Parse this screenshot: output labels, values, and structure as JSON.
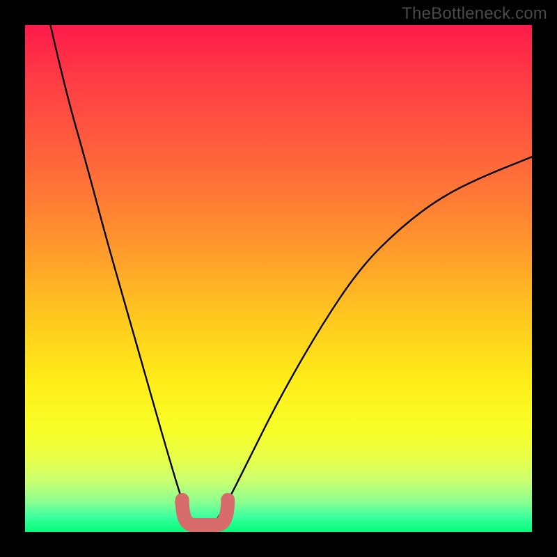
{
  "watermark": "TheBottleneck.com",
  "chart_data": {
    "type": "line",
    "title": "",
    "xlabel": "",
    "ylabel": "",
    "xlim": [
      0,
      100
    ],
    "ylim": [
      0,
      100
    ],
    "legend": false,
    "grid": false,
    "background_gradient": {
      "direction": "vertical",
      "stops": [
        {
          "pos": 0,
          "color": "#ff1a4a"
        },
        {
          "pos": 50,
          "color": "#ffc91f"
        },
        {
          "pos": 85,
          "color": "#f8ff28"
        },
        {
          "pos": 100,
          "color": "#00ff7a"
        }
      ]
    },
    "series": [
      {
        "name": "bottleneck-curve",
        "color": "#000000",
        "x": [
          5,
          8,
          12,
          16,
          20,
          24,
          28,
          31,
          33,
          35,
          37,
          40,
          44,
          50,
          58,
          66,
          74,
          82,
          90,
          100
        ],
        "y": [
          100,
          87,
          73,
          58,
          44,
          30,
          16,
          6,
          1,
          0,
          1,
          6,
          14,
          26,
          40,
          52,
          60,
          66,
          70,
          74
        ]
      }
    ],
    "annotations": [
      {
        "name": "min-highlight",
        "type": "marker-band",
        "color": "#d86b6b",
        "x_range": [
          31,
          40
        ],
        "y": 0
      },
      {
        "name": "min-dot",
        "type": "point",
        "color": "#d86b6b",
        "x": 30.5,
        "y": 5
      }
    ]
  }
}
